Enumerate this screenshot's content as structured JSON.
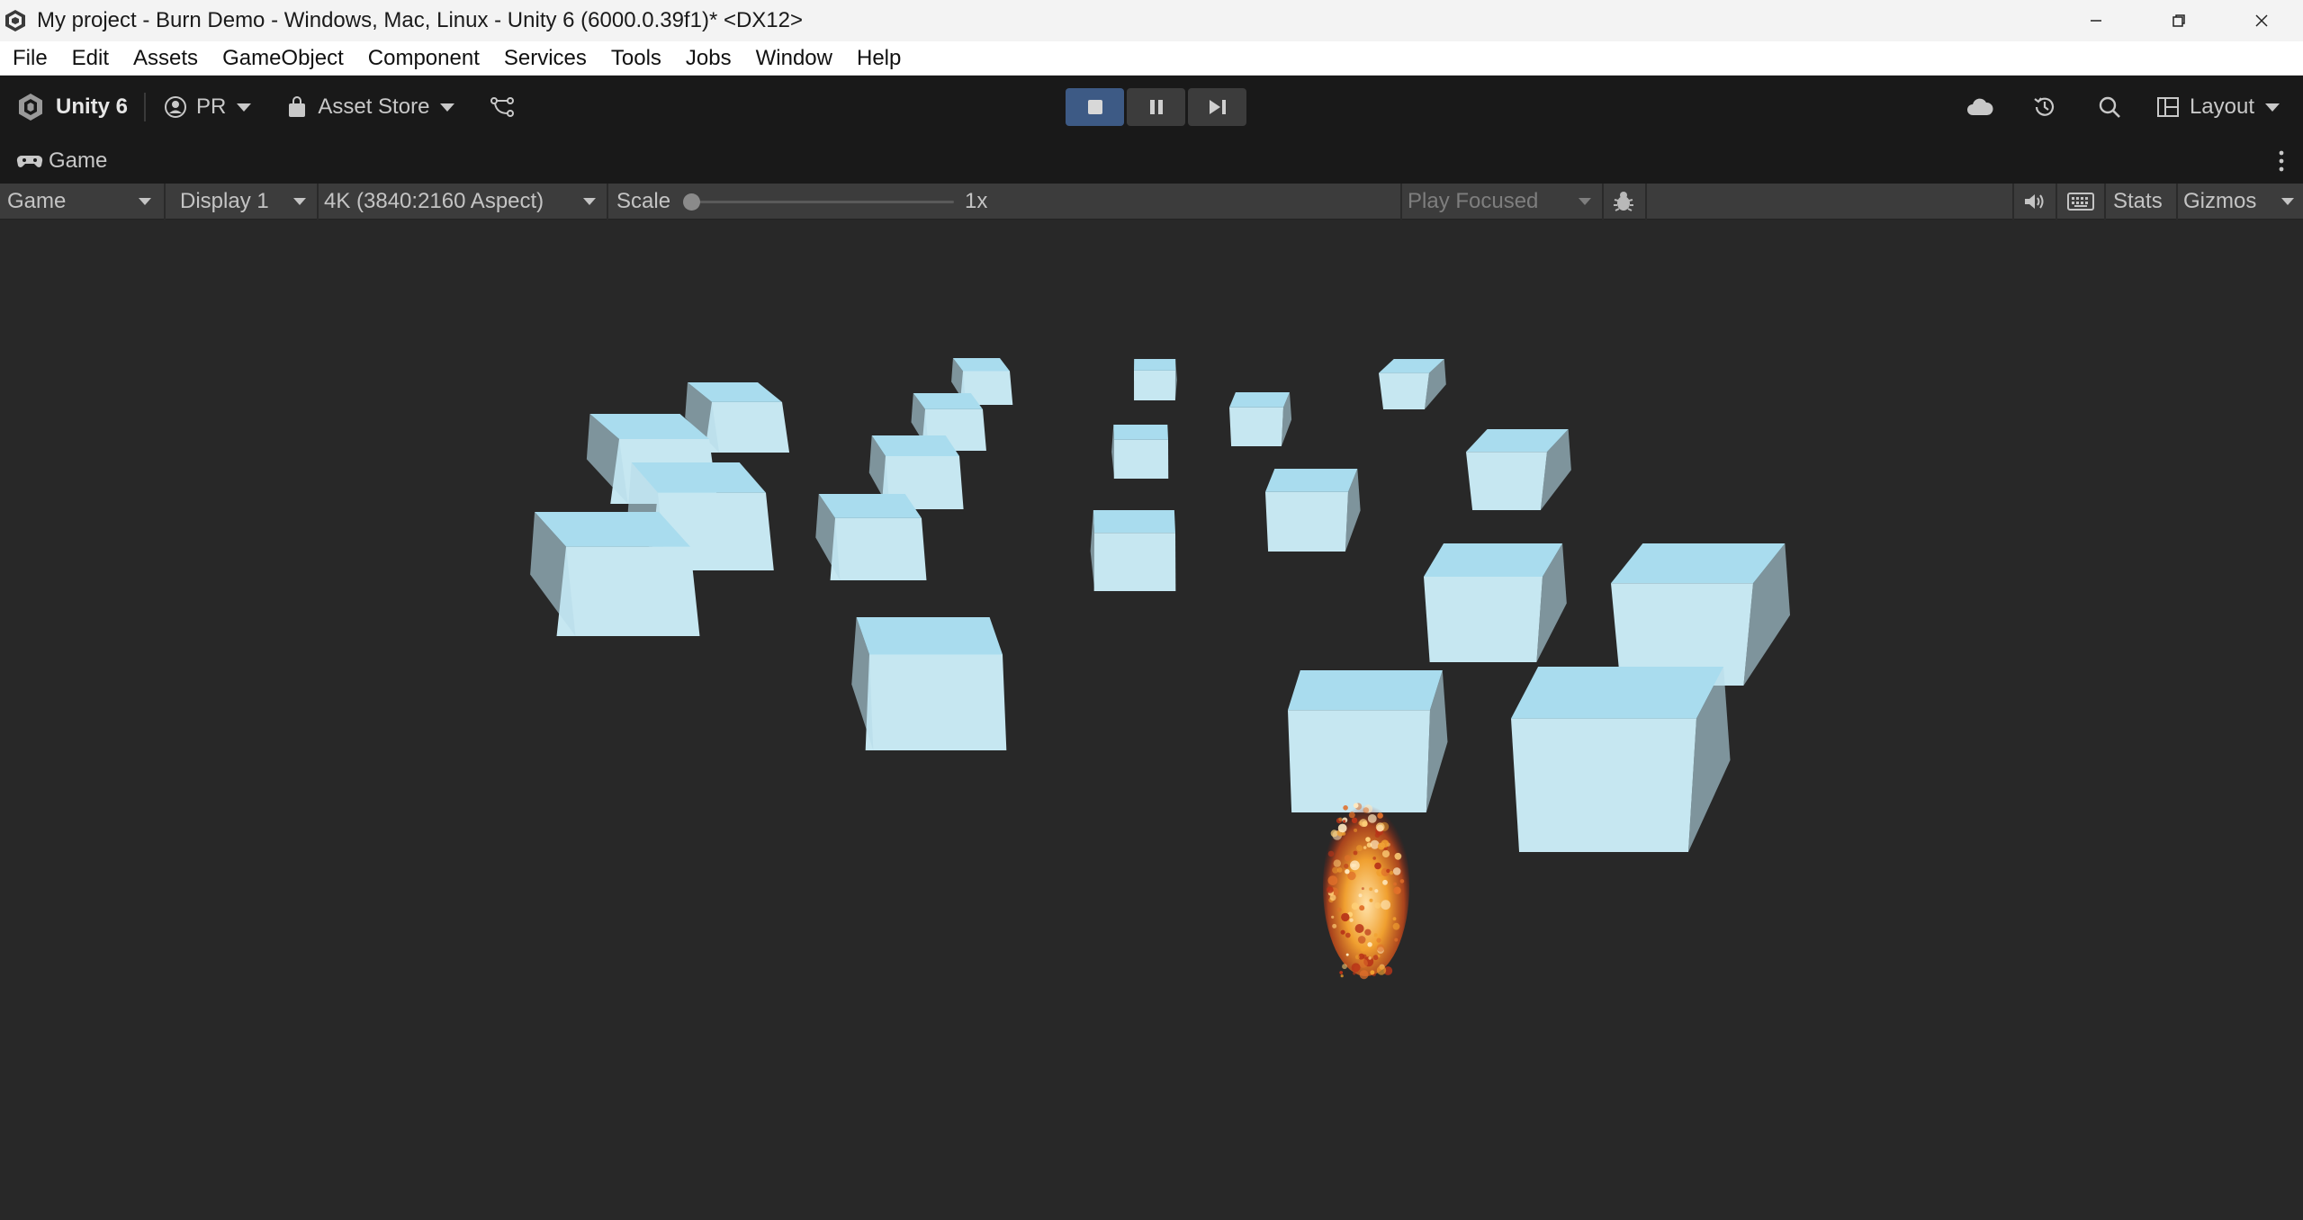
{
  "window": {
    "title": "My project - Burn Demo - Windows, Mac, Linux - Unity 6 (6000.0.39f1)* <DX12>",
    "controls": [
      "minimize-icon",
      "restore-icon",
      "close-icon"
    ]
  },
  "menu": {
    "items": [
      "File",
      "Edit",
      "Assets",
      "GameObject",
      "Component",
      "Services",
      "Tools",
      "Jobs",
      "Window",
      "Help"
    ]
  },
  "toolbar": {
    "brand": "Unity 6",
    "account": "PR",
    "asset_store": "Asset Store",
    "layout": "Layout",
    "play_controls": [
      "stop-icon",
      "pause-icon",
      "step-icon"
    ],
    "play_accent": "#3d5a85"
  },
  "tab": {
    "label": "Game"
  },
  "game_toolbar": {
    "view_mode": "Game",
    "display": "Display 1",
    "resolution": "4K (3840:2160 Aspect)",
    "scale_label": "Scale",
    "scale_value": "1x",
    "scale_level": 0,
    "play_focus": "Play Focused",
    "stats": "Stats",
    "gizmos": "Gizmos"
  },
  "colors": {
    "editor_bg": "#282828",
    "toolbar_bg": "#191919",
    "cube_top": "#a9dcee",
    "cube_side": "#c6e7f1",
    "fire": "#f0a030"
  }
}
